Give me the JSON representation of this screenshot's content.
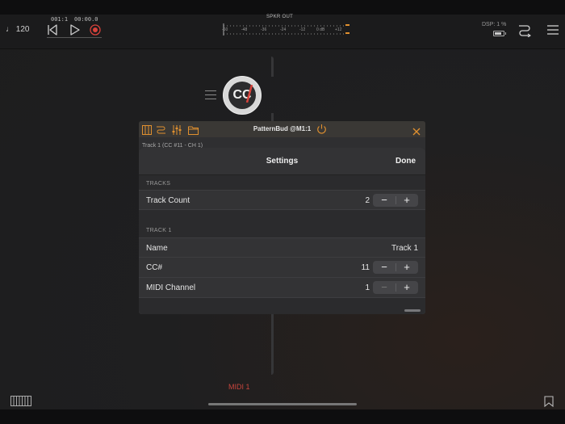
{
  "transport": {
    "tempo": "♩ 120",
    "bar_position": "001:1",
    "time_position": "00:00.0"
  },
  "meter": {
    "label": "SPKR OUT",
    "scale": [
      "-60",
      "-48",
      "-36",
      "-24",
      "-12",
      "0 dB",
      "+12"
    ]
  },
  "status": {
    "dsp": "DSP: 1 %"
  },
  "node": {
    "label": "CC"
  },
  "plugin": {
    "title": "PatternBud @M1:1",
    "subtitle": "Track 1 (CC #11 - CH 1)"
  },
  "settings": {
    "title": "Settings",
    "done_label": "Done",
    "tracks_section": "TRACKS",
    "track_count_label": "Track Count",
    "track_count_value": "2",
    "track1_section": "TRACK 1",
    "name_label": "Name",
    "name_value": "Track 1",
    "cc_label": "CC#",
    "cc_value": "11",
    "midi_channel_label": "MIDI Channel",
    "midi_channel_value": "1",
    "minus": "−",
    "plus": "+"
  },
  "footer": {
    "midi_label": "MIDI 1"
  },
  "colors": {
    "accent_orange": "#e0902f",
    "record_red": "#d8423b",
    "midi_red": "#c8453d"
  }
}
